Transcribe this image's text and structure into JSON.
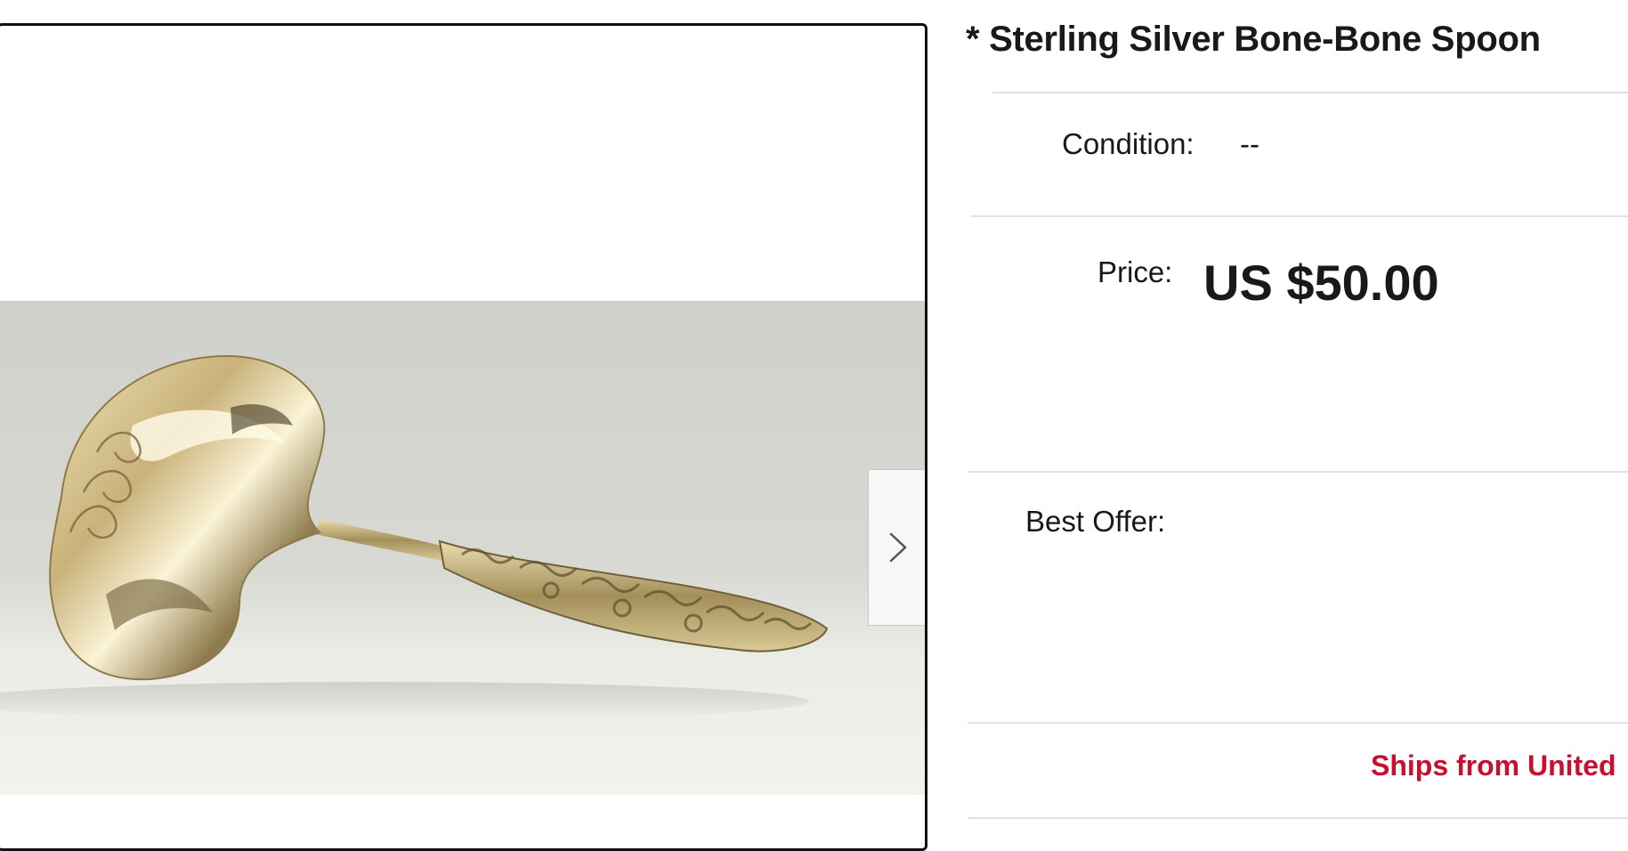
{
  "listing": {
    "title": "* Sterling Silver Bone-Bone Spoon",
    "condition_label": "Condition:",
    "condition_value": "--",
    "price_label": "Price:",
    "price_value": "US $50.00",
    "best_offer_label": "Best Offer:",
    "shipping_text": "Ships from United"
  },
  "gallery": {
    "image_subject": "sterling silver bone spoon with ornate repoussé handle",
    "next_icon": "chevron-right-icon"
  },
  "colors": {
    "shipping_red": "#c8102e",
    "text": "#191919",
    "divider": "#e1e1e1"
  }
}
